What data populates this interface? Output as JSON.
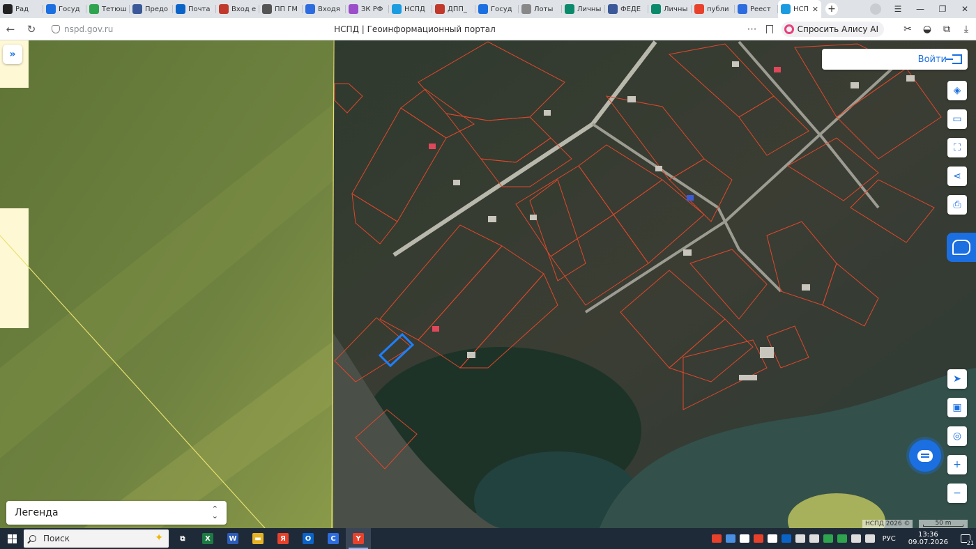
{
  "browser": {
    "tabs": [
      {
        "title": "Рад",
        "icon": "play-icon",
        "color": "#222222"
      },
      {
        "title": "Госуд",
        "icon": "gosuslugi-icon",
        "color": "#1b6fe0"
      },
      {
        "title": "Тетюш",
        "icon": "map-pin-icon",
        "color": "#2ea44f"
      },
      {
        "title": "Предо",
        "icon": "globe-icon",
        "color": "#3b5998"
      },
      {
        "title": "Почта",
        "icon": "outlook-icon",
        "color": "#0a64c8"
      },
      {
        "title": "Вход е",
        "icon": "emblem-icon",
        "color": "#c0392b"
      },
      {
        "title": "ПП ГМ",
        "icon": "eagle-icon",
        "color": "#555555"
      },
      {
        "title": "Входя",
        "icon": "document-icon",
        "color": "#2d6cdf"
      },
      {
        "title": "ЗК РФ",
        "icon": "bear-icon",
        "color": "#9b4dca"
      },
      {
        "title": "НСПД",
        "icon": "nspd-icon",
        "color": "#1b9be0"
      },
      {
        "title": "ДПП_",
        "icon": "pin-icon",
        "color": "#c0392b"
      },
      {
        "title": "Госуд",
        "icon": "gosuslugi-icon",
        "color": "#1b6fe0"
      },
      {
        "title": "Лоты",
        "icon": "page-icon",
        "color": "#888888"
      },
      {
        "title": "Личны",
        "icon": "check-icon",
        "color": "#0a8a6a"
      },
      {
        "title": "ФЕДЕ",
        "icon": "globe-icon",
        "color": "#3b5998"
      },
      {
        "title": "Личны",
        "icon": "check-icon",
        "color": "#0a8a6a"
      },
      {
        "title": "публи",
        "icon": "yandex-icon",
        "color": "#e8412b"
      },
      {
        "title": "Реест",
        "icon": "feather-icon",
        "color": "#2d6cdf"
      },
      {
        "title": "НСП",
        "icon": "nspd-icon",
        "color": "#1b9be0",
        "active": true
      }
    ],
    "close_glyph": "✕",
    "new_tab_glyph": "+",
    "window_controls": [
      "☰",
      "—",
      "❐",
      "✕"
    ],
    "url": "nspd.gov.ru",
    "page_title": "НСПД | Геоинформационный портал",
    "alice_label": "Спросить Алису AI"
  },
  "map": {
    "login_label": "Войти",
    "legend_label": "Легенда",
    "attribution": "НСПД 2026 ©",
    "scale_label": "50 m",
    "tools_top": [
      {
        "name": "layers-icon",
        "glyph": "◈"
      },
      {
        "name": "ruler-icon",
        "glyph": "▭"
      },
      {
        "name": "select-area-icon",
        "glyph": "⛶"
      },
      {
        "name": "share-icon",
        "glyph": "⋖"
      },
      {
        "name": "print-icon",
        "glyph": "⎙"
      }
    ],
    "tools_bottom": [
      {
        "name": "geolocate-icon",
        "glyph": "➤"
      },
      {
        "name": "basemap-icon",
        "glyph": "▣"
      },
      {
        "name": "location-search-icon",
        "glyph": "◎"
      },
      {
        "name": "zoom-in-icon",
        "glyph": "+"
      },
      {
        "name": "zoom-out-icon",
        "glyph": "−"
      }
    ],
    "colors": {
      "parcel_outline": "#e0472b",
      "selected_parcel": "#1e7fff",
      "field": "#6f7f3a",
      "boundary_line": "#e8e070"
    }
  },
  "taskbar": {
    "search_placeholder": "Поиск",
    "apps": [
      {
        "name": "task-view-icon",
        "label": "⧉",
        "color": "#1f2a38"
      },
      {
        "name": "excel-icon",
        "label": "X",
        "color": "#1d7a43"
      },
      {
        "name": "word-icon",
        "label": "W",
        "color": "#2b5cb8"
      },
      {
        "name": "explorer-icon",
        "label": "▬",
        "color": "#e6b325"
      },
      {
        "name": "yandex-icon",
        "label": "Я",
        "color": "#e8412b"
      },
      {
        "name": "outlook-icon",
        "label": "O",
        "color": "#0a64c8"
      },
      {
        "name": "chromium-icon",
        "label": "C",
        "color": "#2d6cdf"
      },
      {
        "name": "yandex-browser-icon",
        "label": "Y",
        "color": "#e8412b",
        "active": true
      }
    ],
    "language": "РУС",
    "time": "13:36",
    "date": "09.07.2026",
    "notifications": "21"
  }
}
